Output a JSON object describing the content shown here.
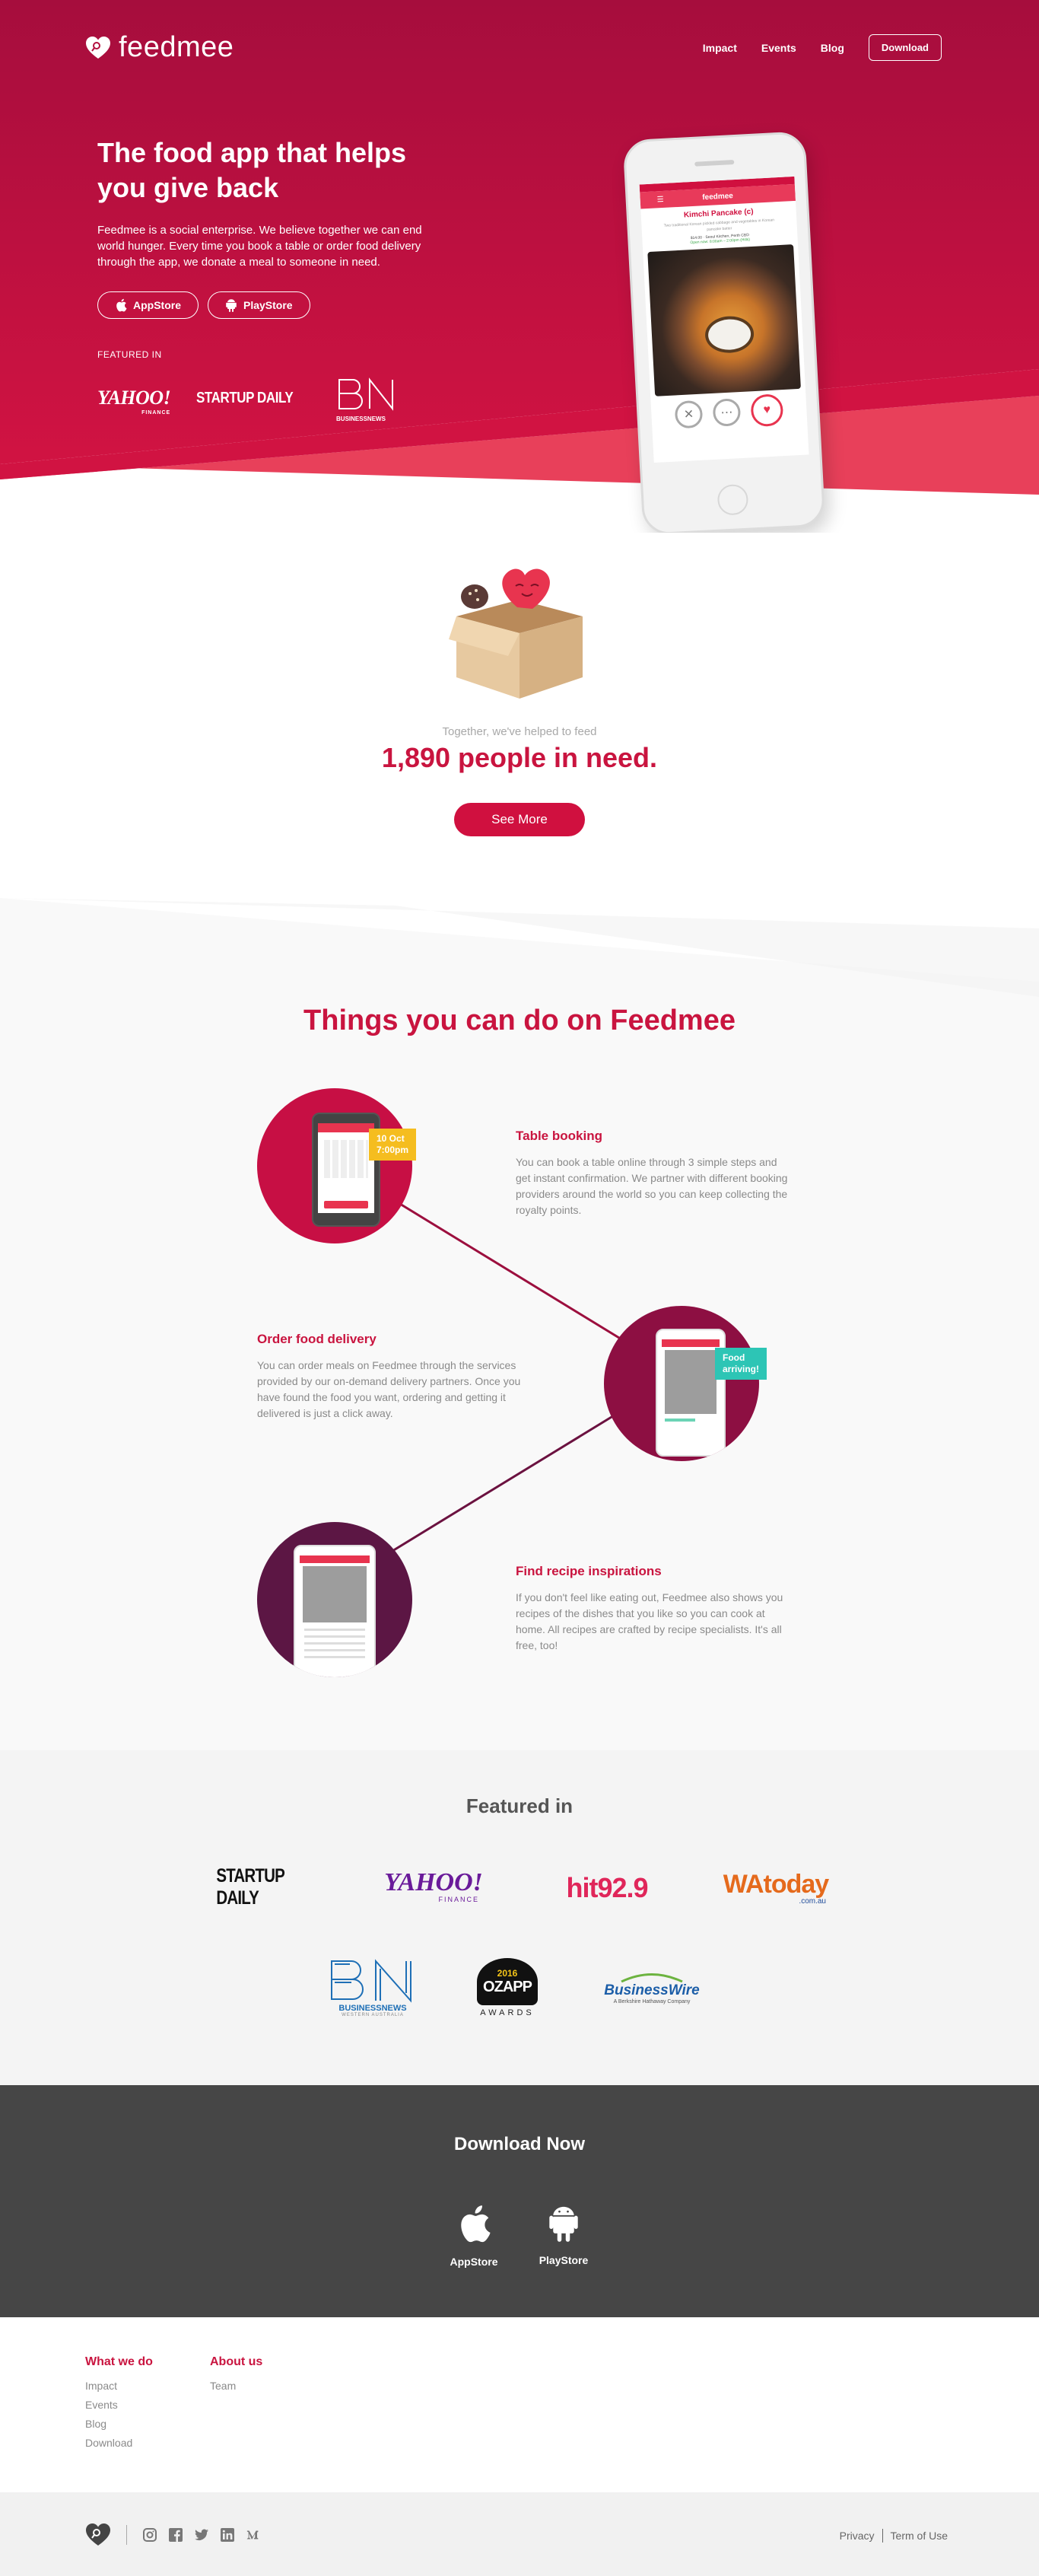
{
  "nav": {
    "brand": "feedmee",
    "links": [
      "Impact",
      "Events",
      "Blog"
    ],
    "download": "Download"
  },
  "hero": {
    "title": "The food app that helps you give back",
    "description": "Feedmee is a social enterprise. We believe together we can end world hunger. Every time you book a table or order food delivery through the app, we donate a meal to someone in need.",
    "appstore": "AppStore",
    "playstore": "PlayStore",
    "featured_label": "FEATURED IN",
    "featured_logos": {
      "yahoo": "YAHOO!",
      "yahoo_sub": "FINANCE",
      "startup": "STARTUP DAILY",
      "bn_sub": "BUSINESSNEWS"
    },
    "phone": {
      "brand": "feedmee",
      "dish": "Kimchi Pancake (c)",
      "dish_desc": "Two traditional Korean pickled cabbage and vegetables in Korean pancake batter",
      "price_line": "$14.00 · Seoul Kitchen, Perth CBD",
      "open_line": "Open now: 8:00am – 2:00pm (Hills)"
    }
  },
  "impact": {
    "subtitle": "Together, we've helped to feed",
    "count": "1,890 people in need.",
    "button": "See More"
  },
  "things": {
    "title": "Things you can do on Feedmee",
    "features": [
      {
        "title": "Table booking",
        "description": "You can book a table online through 3 simple steps and get instant confirmation. We partner with different booking providers around the world so you can keep collecting the royalty points.",
        "tag": "10 Oct\n7:00pm"
      },
      {
        "title": "Order food delivery",
        "description": "You can order meals on Feedmee through the services provided by our on-demand delivery partners. Once you have found the food you want, ordering and getting it delivered is just a click away.",
        "tag": "Food\narriving!"
      },
      {
        "title": "Find recipe inspirations",
        "description": "If you don't feel like eating out, Feedmee also shows you recipes of the dishes that you like so you can cook at home. All recipes are crafted by recipe specialists. It's all free, too!"
      }
    ]
  },
  "featured": {
    "title": "Featured in",
    "logos": {
      "startup": "STARTUP DAILY",
      "yahoo": "YAHOO!",
      "yahoo_sub": "FINANCE",
      "hit": "hit92.9",
      "wa": "WAtoday",
      "wa_sub": ".com.au",
      "bn_sub": "BUSINESSNEWS",
      "bn_sub2": "WESTERN AUSTRALIA",
      "ozapp": "OZAPP",
      "ozapp_sub": "AWARDS",
      "ozapp_year": "2016",
      "bw": "BusinessWire",
      "bw_sub": "A Berkshire Hathaway Company"
    }
  },
  "download": {
    "title": "Download Now",
    "appstore": "AppStore",
    "playstore": "PlayStore"
  },
  "footer": {
    "col1_title": "What we do",
    "col1_items": [
      "Impact",
      "Events",
      "Blog",
      "Download"
    ],
    "col2_title": "About us",
    "col2_items": [
      "Team"
    ],
    "privacy": "Privacy",
    "terms": "Term of Use"
  },
  "colors": {
    "brand": "#c9143f",
    "hero_bg": "#b3103f",
    "dark_bg": "#464646"
  }
}
